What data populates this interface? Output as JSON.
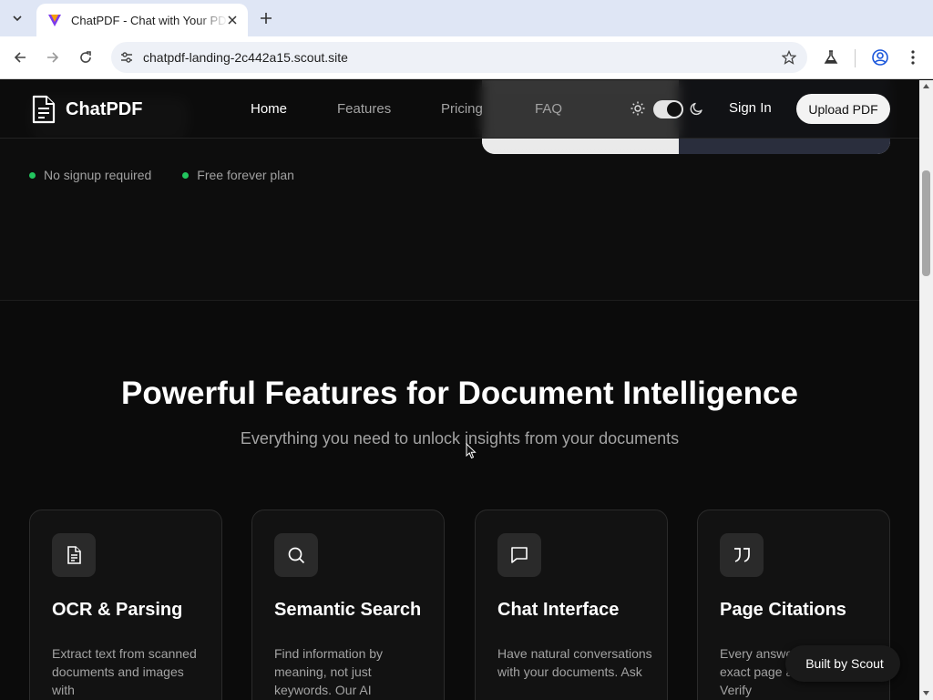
{
  "browser": {
    "tab_title": "ChatPDF - Chat with Your PDF",
    "url": "chatpdf-landing-2c442a15.scout.site",
    "icons": {
      "tab_search": "chevron-down-icon",
      "close": "close-icon",
      "new_tab": "plus-icon",
      "back": "arrow-left-icon",
      "forward": "arrow-right-icon",
      "reload": "reload-icon",
      "site_info": "tune-icon",
      "bookmark": "star-icon",
      "labs": "flask-icon",
      "profile": "account-icon",
      "menu": "kebab-menu-icon"
    }
  },
  "nav": {
    "brand": "ChatPDF",
    "links": [
      "Home",
      "Features",
      "Pricing",
      "FAQ"
    ],
    "active": "Home",
    "sign_in": "Sign In",
    "upload": "Upload PDF",
    "theme_toggle": "dark"
  },
  "hero": {
    "bullets": [
      "No signup required",
      "Free forever plan"
    ]
  },
  "features": {
    "title": "Powerful Features for Document Intelligence",
    "subtitle": "Everything you need to unlock insights from your documents",
    "cards": [
      {
        "icon": "document-icon",
        "title": "OCR & Parsing",
        "desc": "Extract text from scanned documents and images with"
      },
      {
        "icon": "search-icon",
        "title": "Semantic Search",
        "desc": "Find information by meaning, not just keywords. Our AI"
      },
      {
        "icon": "chat-bubble-icon",
        "title": "Chat Interface",
        "desc": "Have natural conversations with your documents. Ask"
      },
      {
        "icon": "quote-icon",
        "title": "Page Citations",
        "desc": "Every answer cites the exact page and quotes. Verify"
      }
    ]
  },
  "badge": {
    "label": "Built by Scout",
    "glyph": ""
  },
  "colors": {
    "page_bg": "#0b0b0b",
    "accent_dot": "#22c55e",
    "card_bg": "#121212",
    "button_bg": "#f3f3f3"
  }
}
